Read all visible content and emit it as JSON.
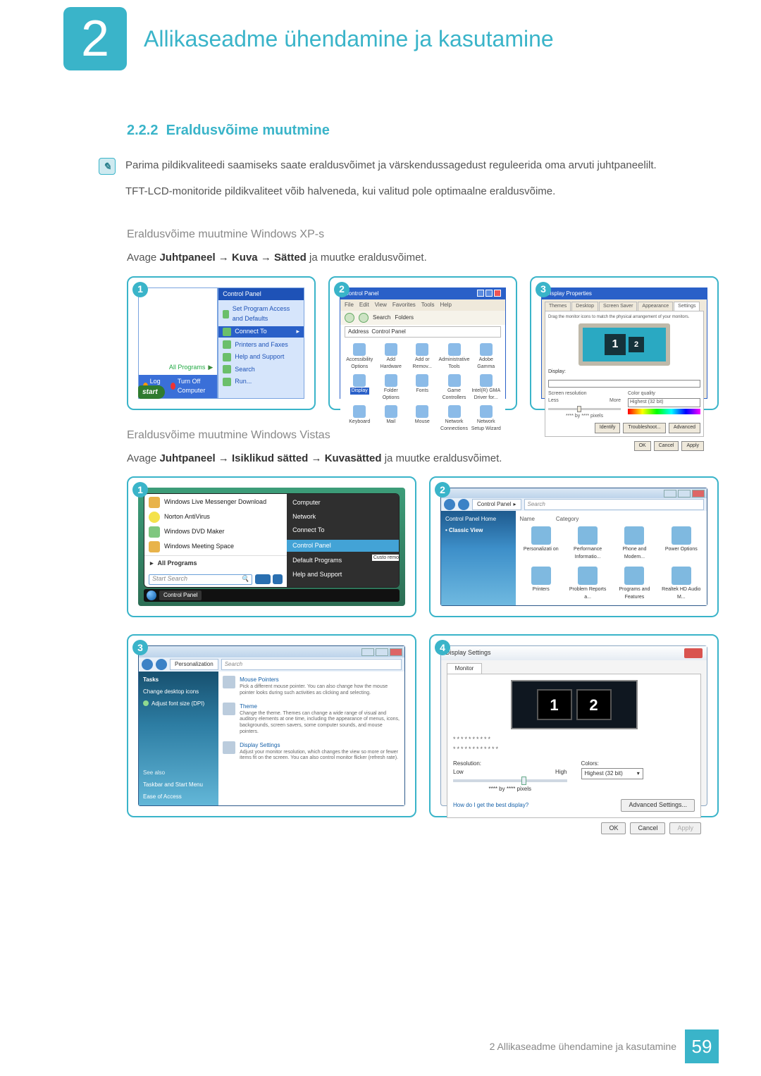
{
  "chapter": {
    "num": "2",
    "title": "Allikaseadme ühendamine ja kasutamine"
  },
  "section": {
    "num": "2.2.2",
    "title": "Eraldusvõime muutmine"
  },
  "info": {
    "p1": "Parima pildikvaliteedi saamiseks saate eraldusvõimet ja värskendussagedust reguleerida oma arvuti juhtpaneelilt.",
    "p2": "TFT-LCD-monitoride pildikvaliteet võib halveneda, kui valitud pole optimaalne eraldusvõime."
  },
  "xp": {
    "heading": "Eraldusvõime muutmine Windows XP-s",
    "instr_pre": "Avage ",
    "path1": "Juhtpaneel",
    "path2": "Kuva",
    "path3": "Sätted",
    "instr_post": " ja muutke eraldusvõimet.",
    "arrow": "→",
    "fig1": {
      "num": "1",
      "header": "Control Panel",
      "items": [
        "Set Program Access and Defaults",
        "Connect To",
        "Printers and Faxes",
        "Help and Support",
        "Search",
        "Run..."
      ],
      "allprograms": "All Programs",
      "logoff": "Log Off",
      "turnoff": "Turn Off Computer",
      "start": "start"
    },
    "fig2": {
      "num": "2",
      "title": "Control Panel",
      "menus": [
        "File",
        "Edit",
        "View",
        "Favorites",
        "Tools",
        "Help"
      ],
      "search": "Search",
      "folders": "Folders",
      "address_lbl": "Address",
      "address": "Control Panel",
      "items": [
        "Accessibility Options",
        "Add Hardware",
        "Add or Remov...",
        "Administrative Tools",
        "Adobe Gamma",
        "Display",
        "Folder Options",
        "Fonts",
        "Game Controllers",
        "Intel(R) GMA Driver for...",
        "Keyboard",
        "Mail",
        "Mouse",
        "Network Connections",
        "Network Setup Wizard"
      ]
    },
    "fig3": {
      "num": "3",
      "title": "Display Properties",
      "tabs": [
        "Themes",
        "Desktop",
        "Screen Saver",
        "Appearance",
        "Settings"
      ],
      "drag_hint": "Drag the monitor icons to match the physical arrangement of your monitors.",
      "mon1": "1",
      "mon2": "2",
      "display_lbl": "Display:",
      "res_lbl": "Screen resolution",
      "less": "Less",
      "more": "More",
      "col_lbl": "Color quality",
      "col_val": "Highest (32 bit)",
      "by": "**** by **** pixels",
      "identify": "Identify",
      "troubleshoot": "Troubleshoot...",
      "advanced": "Advanced",
      "ok": "OK",
      "cancel": "Cancel",
      "apply": "Apply"
    }
  },
  "vista": {
    "heading": "Eraldusvõime muutmine Windows Vistas",
    "instr_pre": "Avage ",
    "path1": "Juhtpaneel",
    "path2": "Isiklikud sätted",
    "path3": "Kuvasätted",
    "instr_post": " ja muutke eraldusvõimet.",
    "arrow": "→",
    "fig1": {
      "num": "1",
      "left": [
        "Windows Live Messenger Download",
        "Norton AntiVirus",
        "Windows DVD Maker",
        "Windows Meeting Space"
      ],
      "allprograms": "All Programs",
      "search_ph": "Start Search",
      "right": [
        "Computer",
        "Network",
        "Connect To",
        "Control Panel",
        "Default Programs",
        "Help and Support"
      ],
      "right_extra": "Custo remo",
      "task": "Control Panel"
    },
    "fig2": {
      "num": "2",
      "path": "Control Panel",
      "search_ph": "Search",
      "side": [
        "Control Panel Home",
        "Classic View"
      ],
      "cols": [
        "Name",
        "Category"
      ],
      "items": [
        "Personalizati on",
        "Performance Informatio...",
        "Phone and Modem...",
        "Power Options",
        "Printers",
        "Problem Reports a...",
        "Programs and Features",
        "Realtek HD Audio M..."
      ]
    },
    "fig3": {
      "num": "3",
      "path": "Personalization",
      "search_ph": "Search",
      "side_hdr": "Tasks",
      "side": [
        "Change desktop icons",
        "Adjust font size (DPI)"
      ],
      "seealso": "See also",
      "seealso_items": [
        "Taskbar and Start Menu",
        "Ease of Access"
      ],
      "sec1_t": "Mouse Pointers",
      "sec1_d": "Pick a different mouse pointer. You can also change how the mouse pointer looks during such activities as clicking and selecting.",
      "sec2_t": "Theme",
      "sec2_d": "Change the theme. Themes can change a wide range of visual and auditory elements at one time, including the appearance of menus, icons, backgrounds, screen savers, some computer sounds, and mouse pointers.",
      "sec3_t": "Display Settings",
      "sec3_d": "Adjust your monitor resolution, which changes the view so more or fewer items fit on the screen. You can also control monitor flicker (refresh rate)."
    },
    "fig4": {
      "num": "4",
      "title": "Display Settings",
      "tab": "Monitor",
      "m1": "1",
      "m2": "2",
      "stars1": "**********",
      "stars2": "************",
      "res": "Resolution:",
      "low": "Low",
      "high": "High",
      "colors": "Colors:",
      "color_val": "Highest (32 bit)",
      "by": "**** by **** pixels",
      "hint": "How do I get the best display?",
      "adv": "Advanced Settings...",
      "ok": "OK",
      "cancel": "Cancel",
      "apply": "Apply"
    }
  },
  "footer": {
    "label": "2 Allikaseadme ühendamine ja kasutamine",
    "page": "59"
  }
}
